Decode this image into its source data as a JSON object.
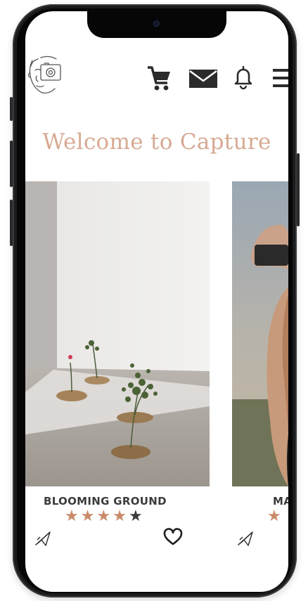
{
  "app": {
    "title": "Welcome to Capture"
  },
  "header": {
    "icons": [
      "face-logo-icon",
      "cart-icon",
      "mail-icon",
      "bell-icon",
      "menu-icon"
    ]
  },
  "cards": [
    {
      "title": "BLOOMING GROUND",
      "rating": 4,
      "max_rating": 5
    },
    {
      "title": "MA",
      "rating": 1,
      "max_rating": 5
    }
  ],
  "colors": {
    "accent": "#d7aa93",
    "star": "#c98b68",
    "text_dark": "#3c3a3d"
  }
}
